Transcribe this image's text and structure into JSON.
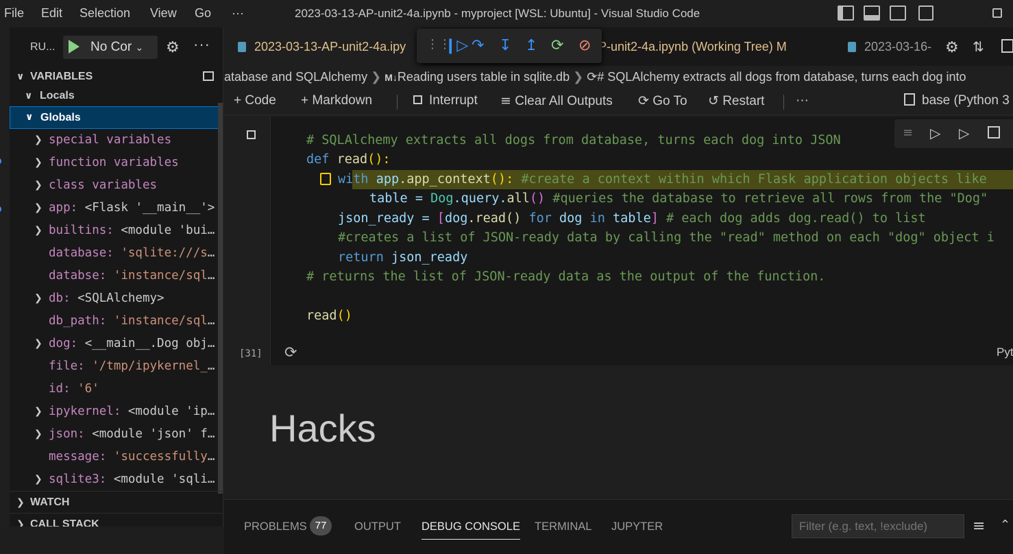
{
  "menu": {
    "file": "File",
    "edit": "Edit",
    "selection": "Selection",
    "view": "View",
    "go": "Go",
    "more": "···"
  },
  "window_title": "2023-03-13-AP-unit2-4a.ipynb - myproject [WSL: Ubuntu] - Visual Studio Code",
  "run": {
    "label": "RU...",
    "config": "No Cor"
  },
  "variables": {
    "header": "VARIABLES",
    "locals": "Locals",
    "globals": "Globals",
    "items": [
      {
        "name": "special variables",
        "value": ""
      },
      {
        "name": "function variables",
        "value": ""
      },
      {
        "name": "class variables",
        "value": ""
      },
      {
        "name": "app:",
        "value": " <Flask '__main__'>"
      },
      {
        "name": "builtins:",
        "value": " <module 'bui..."
      },
      {
        "name": "database:",
        "value": " 'sqlite:///s..."
      },
      {
        "name": "databse:",
        "value": " 'instance/sql..."
      },
      {
        "name": "db:",
        "value": " <SQLAlchemy>"
      },
      {
        "name": "db_path:",
        "value": " 'instance/sql..."
      },
      {
        "name": "dog:",
        "value": " <__main__.Dog obj..."
      },
      {
        "name": "file:",
        "value": " '/tmp/ipykernel_..."
      },
      {
        "name": "id:",
        "value": " '6'"
      },
      {
        "name": "ipykernel:",
        "value": " <module 'ip..."
      },
      {
        "name": "json:",
        "value": " <module 'json' f..."
      },
      {
        "name": "message:",
        "value": " 'successfully..."
      },
      {
        "name": "sqlite3:",
        "value": " <module 'sqli..."
      }
    ]
  },
  "watch": "WATCH",
  "callstack": "CALL STACK",
  "tabs": {
    "t1": "2023-03-13-AP-unit2-4a.ipy",
    "t2": "P-unit2-4a.ipynb (Working Tree)",
    "t2_badge": "M",
    "t3": "2023-03-16-"
  },
  "breadcrumb": {
    "a": "atabase and SQLAlchemy",
    "b": "Reading users table in sqlite.db",
    "c": "# SQLAlchemy extracts all dogs from database, turns each dog into"
  },
  "nbtoolbar": {
    "code": "Code",
    "markdown": "Markdown",
    "interrupt": "Interrupt",
    "clear": "Clear All Outputs",
    "goto": "Go To",
    "restart": "Restart",
    "more": "···",
    "kernel": "base (Python 3"
  },
  "code": {
    "l1": "# SQLAlchemy extracts all dogs from database, turns each dog into JSON",
    "l2a": "def ",
    "l2b": "read",
    "l2c": "():",
    "l3a": "with ",
    "l3b": "app",
    "l3c": ".",
    "l3d": "app_context",
    "l3e": "():",
    "l3f": " #create a context within which Flask application objects like",
    "l4a": "table = ",
    "l4b": "Dog",
    "l4c": ".query.",
    "l4d": "all",
    "l4e": "()",
    "l4f": " #queries the database to retrieve all rows from the \"Dog\"",
    "l5a": "json_ready = ",
    "l5b": "[",
    "l5c": "dog",
    "l5d": ".read() ",
    "l5e": "for ",
    "l5f": "dog ",
    "l5g": "in ",
    "l5h": "table",
    "l5i": "]",
    "l5j": " # each dog adds dog.read() to list",
    "l6": "#creates a list of JSON-ready data by calling the \"read\" method on each \"dog\" object i",
    "l7a": "return ",
    "l7b": "json_ready",
    "l8": "# returns the list of JSON-ready data as the output of the function.",
    "l9a": "read",
    "l9b": "()"
  },
  "exec_count": "[31]",
  "cell_lang": "Pyt",
  "markdown_heading": "Hacks",
  "panel": {
    "problems": "PROBLEMS",
    "problems_count": "77",
    "output": "OUTPUT",
    "debug": "DEBUG CONSOLE",
    "terminal": "TERMINAL",
    "jupyter": "JUPYTER",
    "filter_placeholder": "Filter (e.g. text, !exclude)"
  }
}
